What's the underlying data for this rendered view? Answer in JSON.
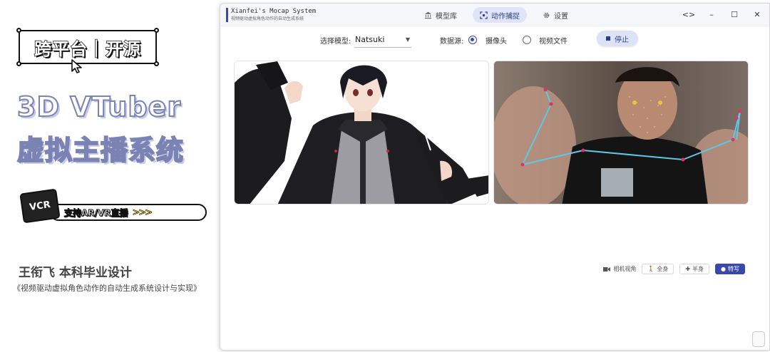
{
  "promo": {
    "badge": "跨平台｜开源",
    "title_line1": "3D VTuber",
    "title_line2": "虚拟主播系统",
    "vcr_label": "VCR",
    "feature_pill": "支持AR/VR直播",
    "feature_arrows": ">>>",
    "author": "王衔飞 本科毕业设计",
    "thesis": "《视频驱动虚拟角色动作的自动生成系统设计与实现》"
  },
  "app": {
    "title": "Xianfei's Mocap System",
    "subtitle": "视频驱动虚拟角色动作的自动生成系统",
    "nav": [
      {
        "label": "模型库",
        "icon": "bank-icon",
        "active": false
      },
      {
        "label": "动作捕捉",
        "icon": "capture-icon",
        "active": true
      },
      {
        "label": "设置",
        "icon": "gear-icon",
        "active": false
      }
    ],
    "window_controls": {
      "code": "<>",
      "minimize": "–",
      "maximize": "☐",
      "close": "✕"
    }
  },
  "toolbar": {
    "model_label": "选择模型:",
    "model_value": "Natsuki",
    "source_label": "数据源:",
    "source_options": [
      {
        "label": "摄像头",
        "selected": true
      },
      {
        "label": "视频文件",
        "selected": false
      }
    ],
    "stop_label": "停止"
  },
  "view_controls": {
    "label": "相机视角",
    "buttons": [
      {
        "label": "全身",
        "active": false
      },
      {
        "label": "半身",
        "active": false
      },
      {
        "label": "特写",
        "active": true
      }
    ]
  },
  "colors": {
    "accent": "#3949ab",
    "accent_light": "#dde3f7",
    "landmark_line": "#5ec8e8",
    "landmark_point": "#e0306a"
  }
}
